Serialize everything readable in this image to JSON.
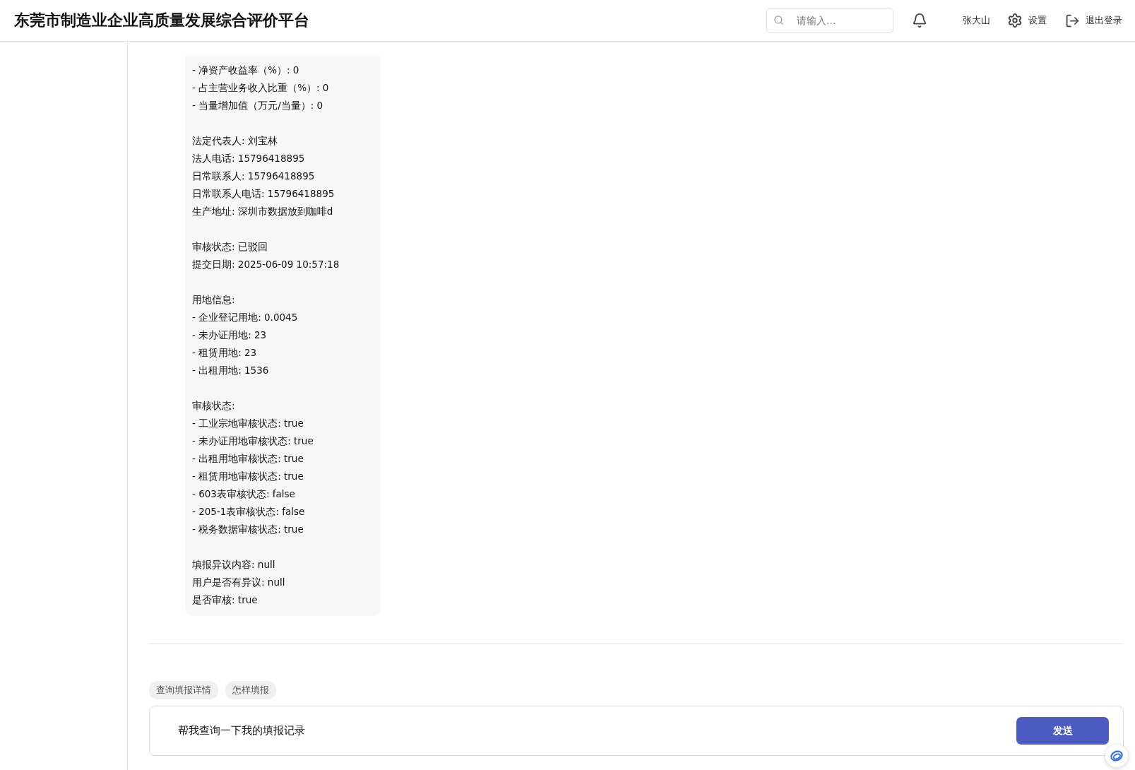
{
  "header": {
    "title": "东莞市制造业企业高质量发展综合评价平台",
    "search": {
      "placeholder": "请输入..."
    },
    "user": "张大山",
    "settings": "设置",
    "logout": "退出登录"
  },
  "message": {
    "groups": [
      [
        "- 净资产收益率（%）: 0",
        "- 占主营业务收入比重（%）: 0",
        "- 当量增加值（万元/当量）: 0"
      ],
      [
        "法定代表人: 刘宝林",
        "法人电话: 15796418895",
        "日常联系人: 15796418895",
        "日常联系人电话: 15796418895",
        "生产地址: 深圳市数据放到咖啡d"
      ],
      [
        "审核状态: 已驳回",
        "提交日期: 2025-06-09 10:57:18"
      ],
      [
        "用地信息:",
        "- 企业登记用地: 0.0045",
        "- 未办证用地: 23",
        "- 租赁用地: 23",
        "- 出租用地: 1536"
      ],
      [
        "审核状态:",
        "- 工业宗地审核状态: true",
        "- 未办证用地审核状态: true",
        "- 出租用地审核状态: true",
        "- 租赁用地审核状态: true",
        "- 603表审核状态: false",
        "- 205-1表审核状态: false",
        "- 税务数据审核状态: true"
      ],
      [
        "填报异议内容: null",
        "用户是否有异议: null",
        "是否审核: true"
      ]
    ]
  },
  "suggestions": [
    "查询填报详情",
    "怎样填报"
  ],
  "composer": {
    "value": "帮我查询一下我的填报记录",
    "send": "发送"
  }
}
